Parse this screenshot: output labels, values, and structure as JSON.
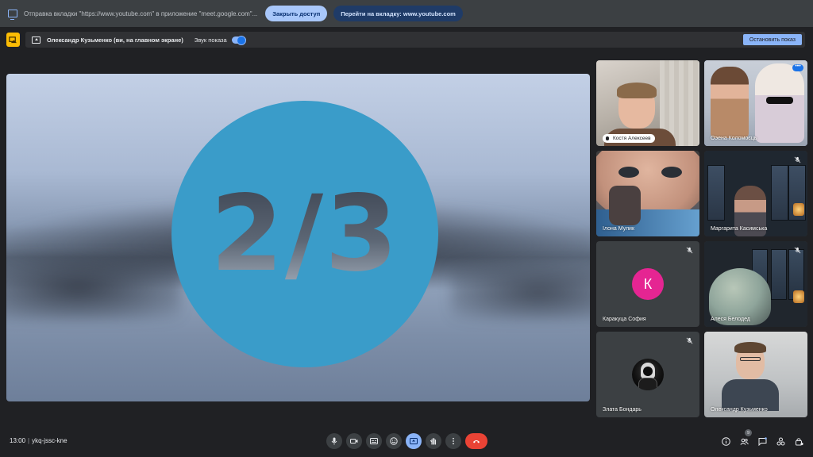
{
  "share_bar": {
    "message": "Отправка вкладки \"https://www.youtube.com\" в приложение \"meet.google.com\"...",
    "stop_access_label": "Закрыть доступ",
    "go_to_tab_label": "Перейти на вкладку: www.youtube.com"
  },
  "presenting_bar": {
    "presenter": "Олександр Кузьменко (ви, на главном экране)",
    "sound_label": "Звук показа",
    "sound_enabled": true,
    "stop_show_label": "Остановить показ"
  },
  "presentation": {
    "counter": "2/3",
    "circle_color": "#3a9cc9"
  },
  "participants": [
    {
      "name": "Костя Алексеев",
      "muted": false,
      "speaking_pill": true
    },
    {
      "name": "Оэена Коломоєць",
      "muted": false,
      "active": true
    },
    {
      "name": "Ілона Мулик",
      "muted": false
    },
    {
      "name": "Маргарита Касимська",
      "muted": true
    },
    {
      "name": "Каракуца София",
      "muted": true,
      "avatar_letter": "К",
      "avatar_color": "#e52592"
    },
    {
      "name": "Алеся Белодед",
      "muted": true
    },
    {
      "name": "Злата Бондарь",
      "muted": true
    },
    {
      "name": "Олександр Кузьменко",
      "muted": false
    }
  ],
  "footer": {
    "time": "13:00",
    "separator": "|",
    "meeting_code": "ykq-jssc-kne",
    "people_count": "9",
    "controls": [
      "mic-icon",
      "camera-icon",
      "captions-icon",
      "emoji-icon",
      "present-icon",
      "raise-hand-icon",
      "more-icon",
      "end-call-icon"
    ],
    "right_controls": [
      "info-icon",
      "people-icon",
      "chat-icon",
      "activities-icon",
      "host-controls-icon"
    ]
  },
  "colors": {
    "accent": "#8ab4f8",
    "end_call": "#ea4335",
    "background": "#202124"
  }
}
